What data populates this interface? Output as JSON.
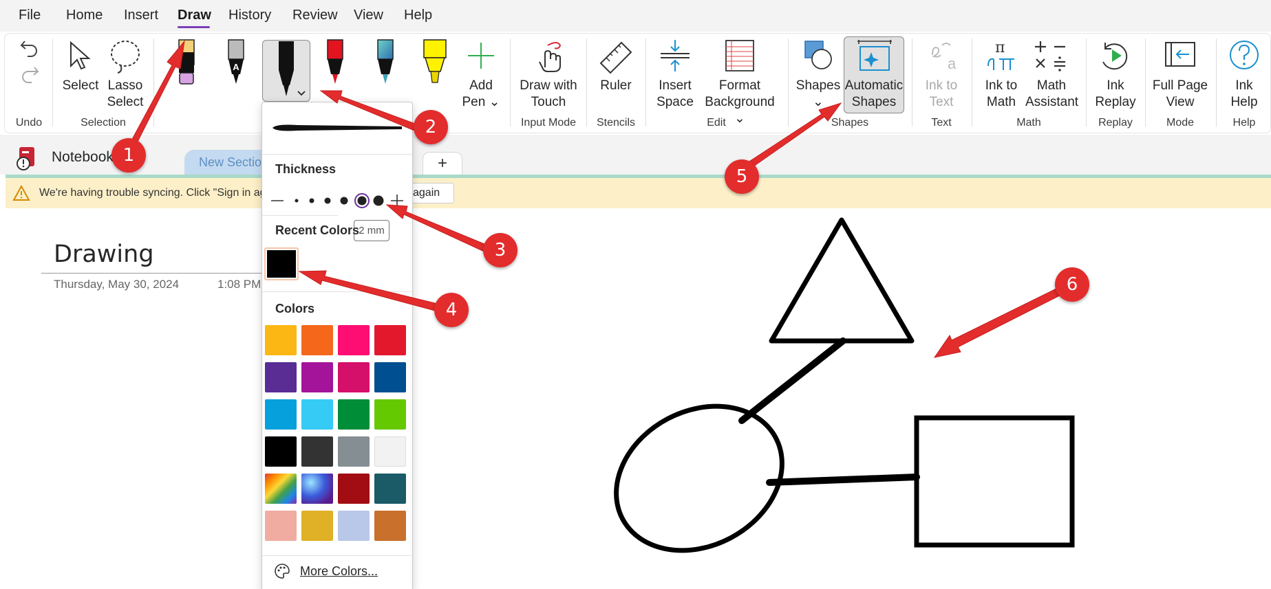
{
  "menu": {
    "items": [
      "File",
      "Home",
      "Insert",
      "Draw",
      "History",
      "Review",
      "View",
      "Help"
    ],
    "active": "Draw"
  },
  "ribbon": {
    "undo_group": "Undo",
    "selection": {
      "label": "Selection",
      "select": "Select",
      "lasso_line1": "Lasso",
      "lasso_line2": "Select"
    },
    "add_pen": {
      "line1": "Add",
      "line2": "Pen ⌄"
    },
    "input_mode": {
      "label": "Input Mode",
      "line1": "Draw with",
      "line2": "Touch"
    },
    "stencils": {
      "label": "Stencils",
      "ruler": "Ruler"
    },
    "edit": {
      "label": "Edit",
      "insert_line1": "Insert",
      "insert_line2": "Space",
      "format_line1": "Format",
      "format_line2": "Background ⌄"
    },
    "shapes": {
      "label": "Shapes",
      "shapes": "Shapes",
      "auto_line1": "Automatic",
      "auto_line2": "Shapes"
    },
    "text": {
      "label": "Text",
      "line1": "Ink to",
      "line2": "Text"
    },
    "math": {
      "label": "Math",
      "ink_line1": "Ink to",
      "ink_line2": "Math",
      "assist_line1": "Math",
      "assist_line2": "Assistant"
    },
    "replay": {
      "label": "Replay",
      "line1": "Ink",
      "line2": "Replay"
    },
    "mode": {
      "label": "Mode",
      "line1": "Full Page",
      "line2": "View"
    },
    "help": {
      "label": "Help",
      "line1": "Ink",
      "line2": "Help"
    }
  },
  "notebook": {
    "name": "Notebook",
    "section_tab": "New Sectio",
    "add_tab": "+"
  },
  "warning": {
    "text": "We're having trouble syncing. Click \"Sign in ag",
    "button": "again"
  },
  "page": {
    "title": "Drawing",
    "date": "Thursday, May 30, 2024",
    "time": "1:08 PM"
  },
  "pen_dropdown": {
    "thickness_label": "Thickness",
    "tooltip": "2 mm",
    "recent_label": "Recent Colors",
    "colors_label": "Colors",
    "more_colors": "More Colors...",
    "recent_color": "#000000",
    "colors": [
      "#fcb714",
      "#f5671b",
      "#fe0e72",
      "#e4182d",
      "#5a2d95",
      "#a3149a",
      "#d5106a",
      "#004f90",
      "#06a0dd",
      "#36cbf4",
      "#008d38",
      "#65c901",
      "#000000",
      "#333333",
      "#858e93",
      "#f2f2f2"
    ],
    "texture_colors": [
      "rainbow",
      "galaxy",
      "#a10d12",
      "#1b5a67",
      "#f0aca0",
      "#e0b026",
      "#b9c8e8",
      "#c8702c"
    ]
  },
  "callouts": [
    "1",
    "2",
    "3",
    "4",
    "5",
    "6"
  ],
  "colors": {
    "accent": "#7a3fb8",
    "callout": "#e32c2c",
    "warning_bg": "#fdf0c8"
  }
}
